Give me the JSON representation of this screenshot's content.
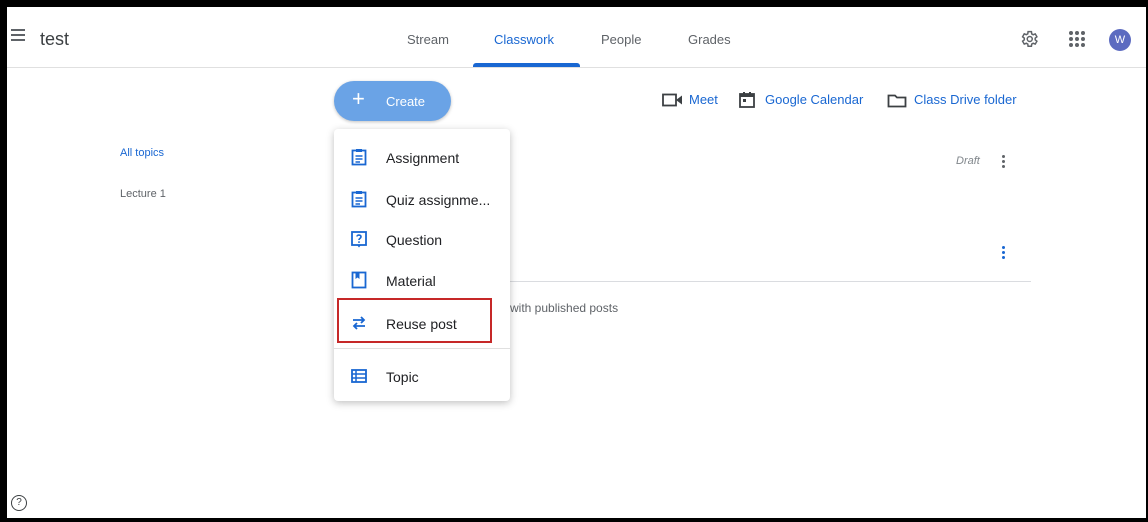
{
  "header": {
    "class_title": "test",
    "tabs": [
      {
        "label": "Stream"
      },
      {
        "label": "Classwork",
        "active": true
      },
      {
        "label": "People"
      },
      {
        "label": "Grades"
      }
    ],
    "avatar_initial": "W"
  },
  "toolbar": {
    "create_label": "Create",
    "create_icon": "+",
    "meet_label": "Meet",
    "calendar_label": "Google Calendar",
    "drive_label": "Class Drive folder"
  },
  "sidebar": {
    "items": [
      {
        "label": "All topics",
        "active": true
      },
      {
        "label": "Lecture 1"
      }
    ]
  },
  "main": {
    "draft_label": "Draft",
    "empty_text": "with published posts"
  },
  "create_menu": {
    "items": [
      {
        "label": "Assignment",
        "icon": "assignment-icon"
      },
      {
        "label": "Quiz assignme...",
        "icon": "quiz-assignment-icon"
      },
      {
        "label": "Question",
        "icon": "question-icon"
      },
      {
        "label": "Material",
        "icon": "material-icon"
      },
      {
        "label": "Reuse post",
        "icon": "reuse-post-icon",
        "highlighted": true
      },
      {
        "label": "Topic",
        "icon": "topic-icon"
      }
    ]
  },
  "help_icon": "?",
  "colors": {
    "accent": "#1967d2",
    "create_button": "#6aa3e6",
    "avatar": "#5c6bc0",
    "highlight_box": "#c62828"
  }
}
